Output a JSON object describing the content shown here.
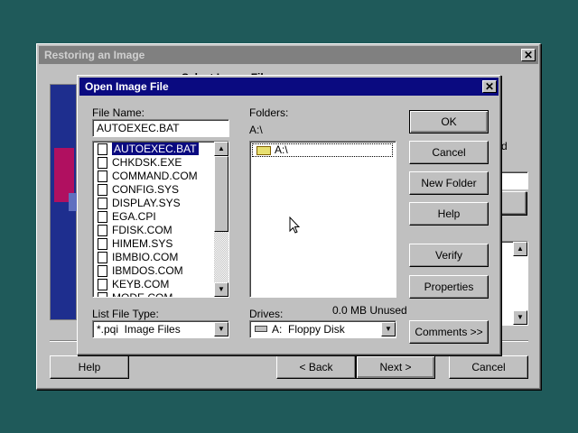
{
  "background_window": {
    "title": "Restoring an Image",
    "close_glyph": "✕",
    "partial_heading": "Select Image File",
    "partial_side_text": "d",
    "buttons": {
      "help": "Help",
      "back": "< Back",
      "next": "Next >",
      "cancel": "Cancel"
    }
  },
  "dialog": {
    "title": "Open Image File",
    "close_glyph": "✕",
    "file_name_label": "File Name:",
    "file_name_value": "AUTOEXEC.BAT",
    "files": [
      "AUTOEXEC.BAT",
      "CHKDSK.EXE",
      "COMMAND.COM",
      "CONFIG.SYS",
      "DISPLAY.SYS",
      "EGA.CPI",
      "FDISK.COM",
      "HIMEM.SYS",
      "IBMBIO.COM",
      "IBMDOS.COM",
      "KEYB.COM",
      "MODE.COM"
    ],
    "selected_file_index": 0,
    "folders_label": "Folders:",
    "current_path": "A:\\",
    "folder_items": [
      "A:\\"
    ],
    "drive_space": "0.0 MB Unused",
    "list_type_label": "List File Type:",
    "list_type_value": "*.pqi  Image Files",
    "drives_label": "Drives:",
    "drives_value": "A:  Floppy Disk",
    "buttons": {
      "ok": "OK",
      "cancel": "Cancel",
      "new_folder": "New Folder",
      "help": "Help",
      "verify": "Verify",
      "properties": "Properties",
      "comments": "Comments >>"
    }
  },
  "colors": {
    "desktop": "#1f5a5a",
    "active_title": "#0a0a80",
    "inactive_title": "#808080",
    "face": "#c0c0c0"
  }
}
